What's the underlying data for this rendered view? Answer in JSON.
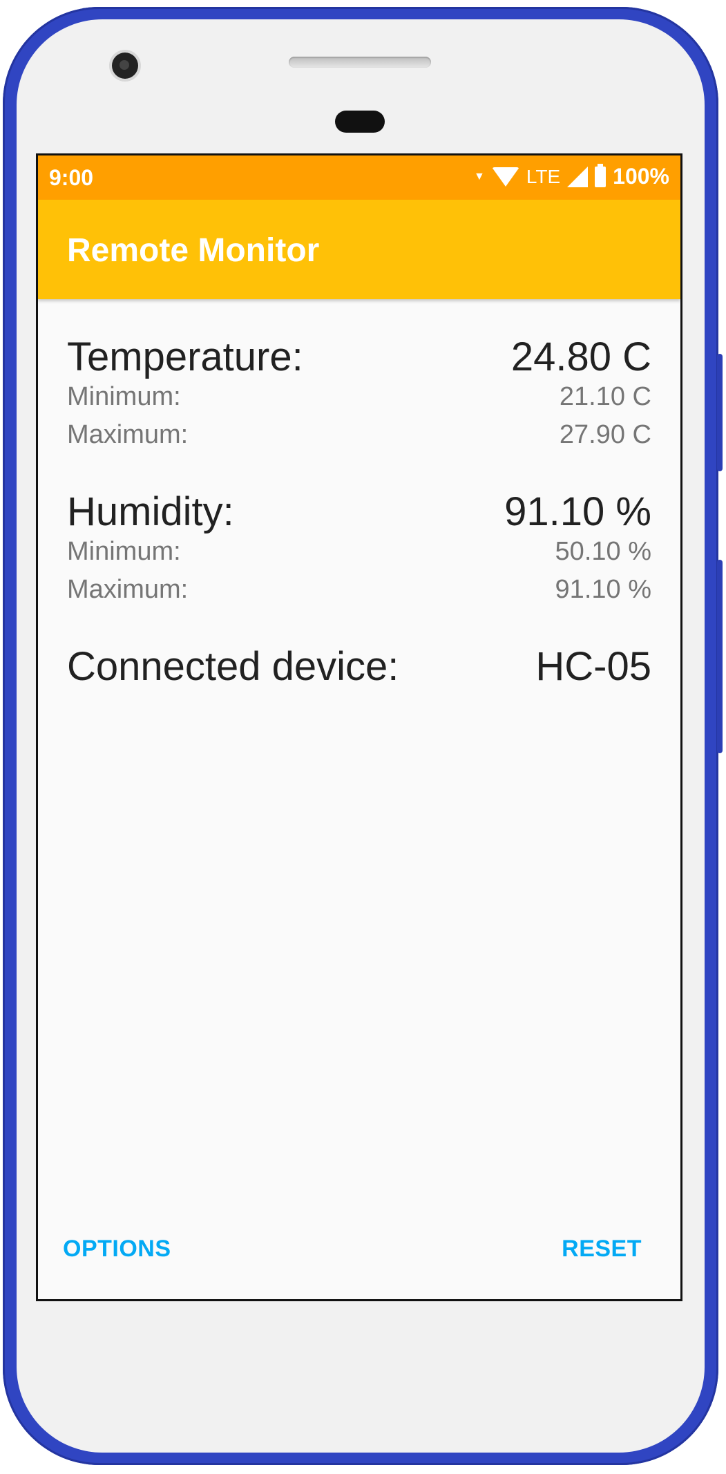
{
  "status_bar": {
    "time": "9:00",
    "network": "LTE",
    "battery": "100%",
    "icons": [
      "data-arrow-icon",
      "wifi-icon",
      "signal-icon",
      "battery-icon"
    ]
  },
  "app_bar": {
    "title": "Remote Monitor"
  },
  "temperature": {
    "label": "Temperature:",
    "value": "24.80 C",
    "min_label": "Minimum:",
    "min_value": "21.10 C",
    "max_label": "Maximum:",
    "max_value": "27.90 C"
  },
  "humidity": {
    "label": "Humidity:",
    "value": "91.10 %",
    "min_label": "Minimum:",
    "min_value": "50.10 %",
    "max_label": "Maximum:",
    "max_value": "91.10 %"
  },
  "device": {
    "label": "Connected device:",
    "value": "HC-05"
  },
  "buttons": {
    "options": "OPTIONS",
    "reset": "RESET"
  },
  "colors": {
    "status_bar": "#ff9f00",
    "app_bar": "#ffc107",
    "button_text": "#03a9f4",
    "phone_frame": "#3045c2"
  }
}
